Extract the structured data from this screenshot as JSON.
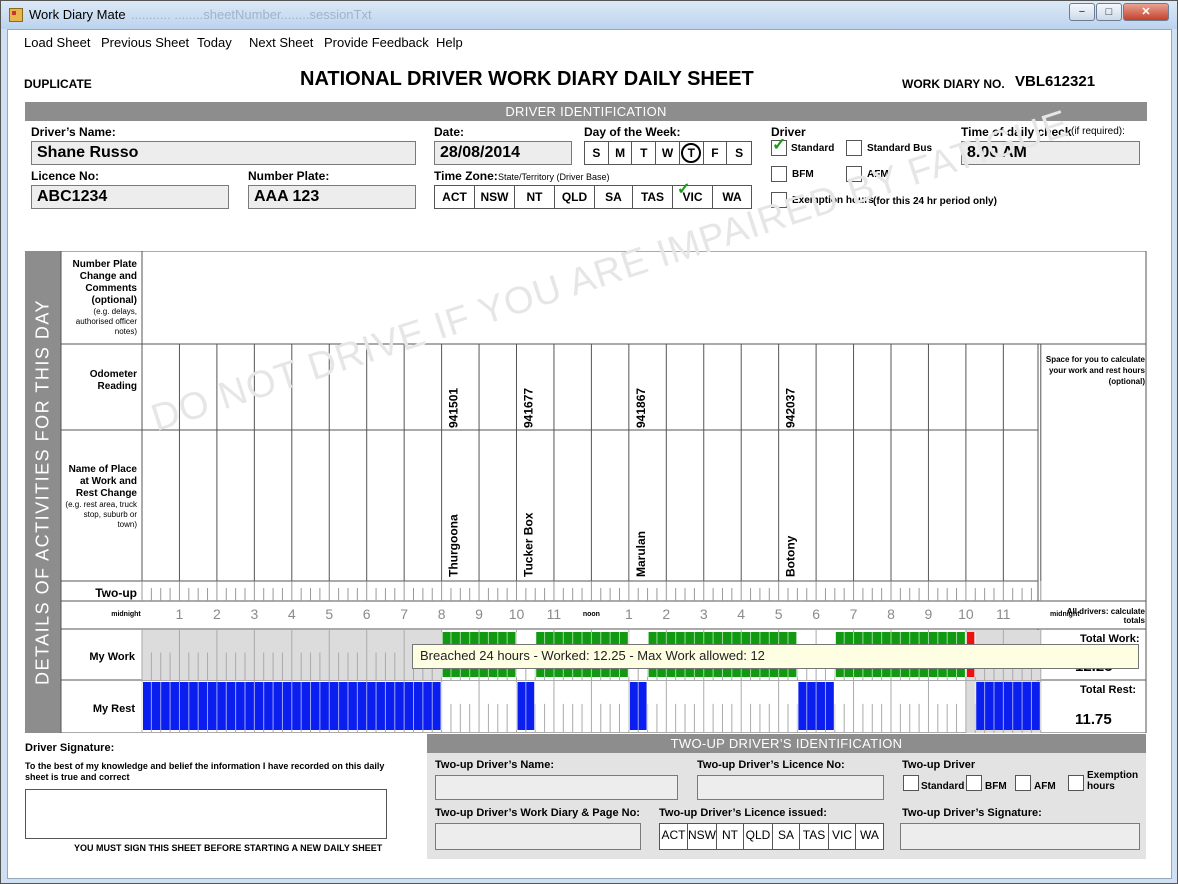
{
  "window": {
    "title": "Work Diary Mate",
    "ghost_text": "...........  ........sheetNumber........sessionTxt",
    "min": "−",
    "max": "□",
    "close": "✕"
  },
  "menu": [
    "Load Sheet",
    "Previous Sheet",
    "Today",
    "Next Sheet",
    "Provide Feedback",
    "Help"
  ],
  "sheet": {
    "duplicate": "DUPLICATE",
    "title": "NATIONAL DRIVER WORK DIARY DAILY SHEET",
    "work_diary_no_label": "WORK DIARY NO.",
    "work_diary_no": "VBL612321",
    "driver_id_header": "DRIVER IDENTIFICATION",
    "drivers_name_label": "Driver’s Name:",
    "drivers_name": "Shane Russo",
    "date_label": "Date:",
    "date": "28/08/2014",
    "day_label": "Day of the Week:",
    "days": [
      "S",
      "M",
      "T",
      "W",
      "T",
      "F",
      "S"
    ],
    "selected_day_index": 4,
    "driver_label": "Driver",
    "driver_types": {
      "standard": "Standard",
      "standard_bus": "Standard Bus",
      "bfm": "BFM",
      "afm": "AFM",
      "exemption": "Exemption hours",
      "exemption_note": "(for this 24 hr period only)"
    },
    "driver_type_selected": "Standard",
    "daily_check_label": "Time of daily check",
    "daily_check_note": "(if required):",
    "daily_check": "8.00 AM",
    "licence_label": "Licence No:",
    "licence": "ABC1234",
    "plate_label": "Number Plate:",
    "plate": "AAA 123",
    "timezone_label": "Time Zone:",
    "timezone_note": "State/Territory (Driver Base)",
    "timezones": [
      "ACT",
      "NSW",
      "NT",
      "QLD",
      "SA",
      "TAS",
      "VIC",
      "WA"
    ],
    "timezone_selected": "VIC"
  },
  "grid": {
    "side_label": "DETAILS OF ACTIVITIES FOR THIS DAY",
    "rows": {
      "plate_change": {
        "label": "Number Plate Change and Comments (optional)",
        "note": "(e.g. delays, authorised officer notes)"
      },
      "odometer": {
        "label": "Odometer Reading"
      },
      "place": {
        "label": "Name of Place at Work and Rest Change",
        "note": "(e.g. rest area, truck stop, suburb or town)"
      },
      "two_up": {
        "label": "Two-up"
      },
      "my_work": {
        "label": "My Work"
      },
      "my_rest": {
        "label": "My Rest"
      }
    },
    "calc_note": "Space for you to calculate your work and rest hours (optional)",
    "all_drivers_note": "All drivers: calculate totals",
    "hour_labels": [
      "midnight",
      "1",
      "2",
      "3",
      "4",
      "5",
      "6",
      "7",
      "8",
      "9",
      "10",
      "11",
      "noon",
      "1",
      "2",
      "3",
      "4",
      "5",
      "6",
      "7",
      "8",
      "9",
      "10",
      "11",
      "midnight"
    ],
    "entries": [
      {
        "odometer": "941501",
        "place": "Thurgoona",
        "hour": 8
      },
      {
        "odometer": "941677",
        "place": "Tucker Box",
        "hour": 10
      },
      {
        "odometer": "941867",
        "place": "Marulan",
        "hour": 13
      },
      {
        "odometer": "942037",
        "place": "Botony",
        "hour": 17
      }
    ],
    "work_periods": [
      [
        8,
        10
      ],
      [
        10.5,
        13
      ],
      [
        13.5,
        17.5
      ],
      [
        18.5,
        22
      ],
      [
        22,
        22.25
      ]
    ],
    "breach_period": [
      22,
      22.25
    ],
    "rest_periods": [
      [
        0,
        8
      ],
      [
        10,
        10.5
      ],
      [
        13,
        13.5
      ],
      [
        17.5,
        18.5
      ],
      [
        22.25,
        24
      ]
    ],
    "total_work_label": "Total Work:",
    "total_work": "12.25",
    "total_rest_label": "Total Rest:",
    "total_rest": "11.75",
    "colors": {
      "work": "#119a11",
      "rest": "#0a1ef0",
      "breach": "#ee1111",
      "shaded": "#dcdcdc"
    }
  },
  "tooltip": "Breached 24 hours - Worked: 12.25 - Max Work allowed: 12",
  "watermark": "DO NOT DRIVE IF YOU ARE IMPAIRED BY FATIGUE",
  "signature": {
    "label": "Driver Signature:",
    "declaration": "To the best of my knowledge and belief the information I have recorded on this daily sheet is true and correct",
    "must_sign": "YOU MUST SIGN THIS SHEET BEFORE STARTING A NEW DAILY SHEET"
  },
  "two_up": {
    "header": "TWO-UP DRIVER’S IDENTIFICATION",
    "name_label": "Two-up Driver’s Name:",
    "licence_label": "Two-up Driver’s Licence No:",
    "driver_label": "Two-up Driver",
    "diary_label": "Two-up Driver’s Work Diary & Page No:",
    "licence_issued_label": "Two-up Driver’s Licence issued:",
    "signature_label": "Two-up Driver’s Signature:",
    "types": [
      "Standard",
      "BFM",
      "AFM",
      "Exemption hours"
    ],
    "states": [
      "ACT",
      "NSW",
      "NT",
      "QLD",
      "SA",
      "TAS",
      "VIC",
      "WA"
    ]
  }
}
